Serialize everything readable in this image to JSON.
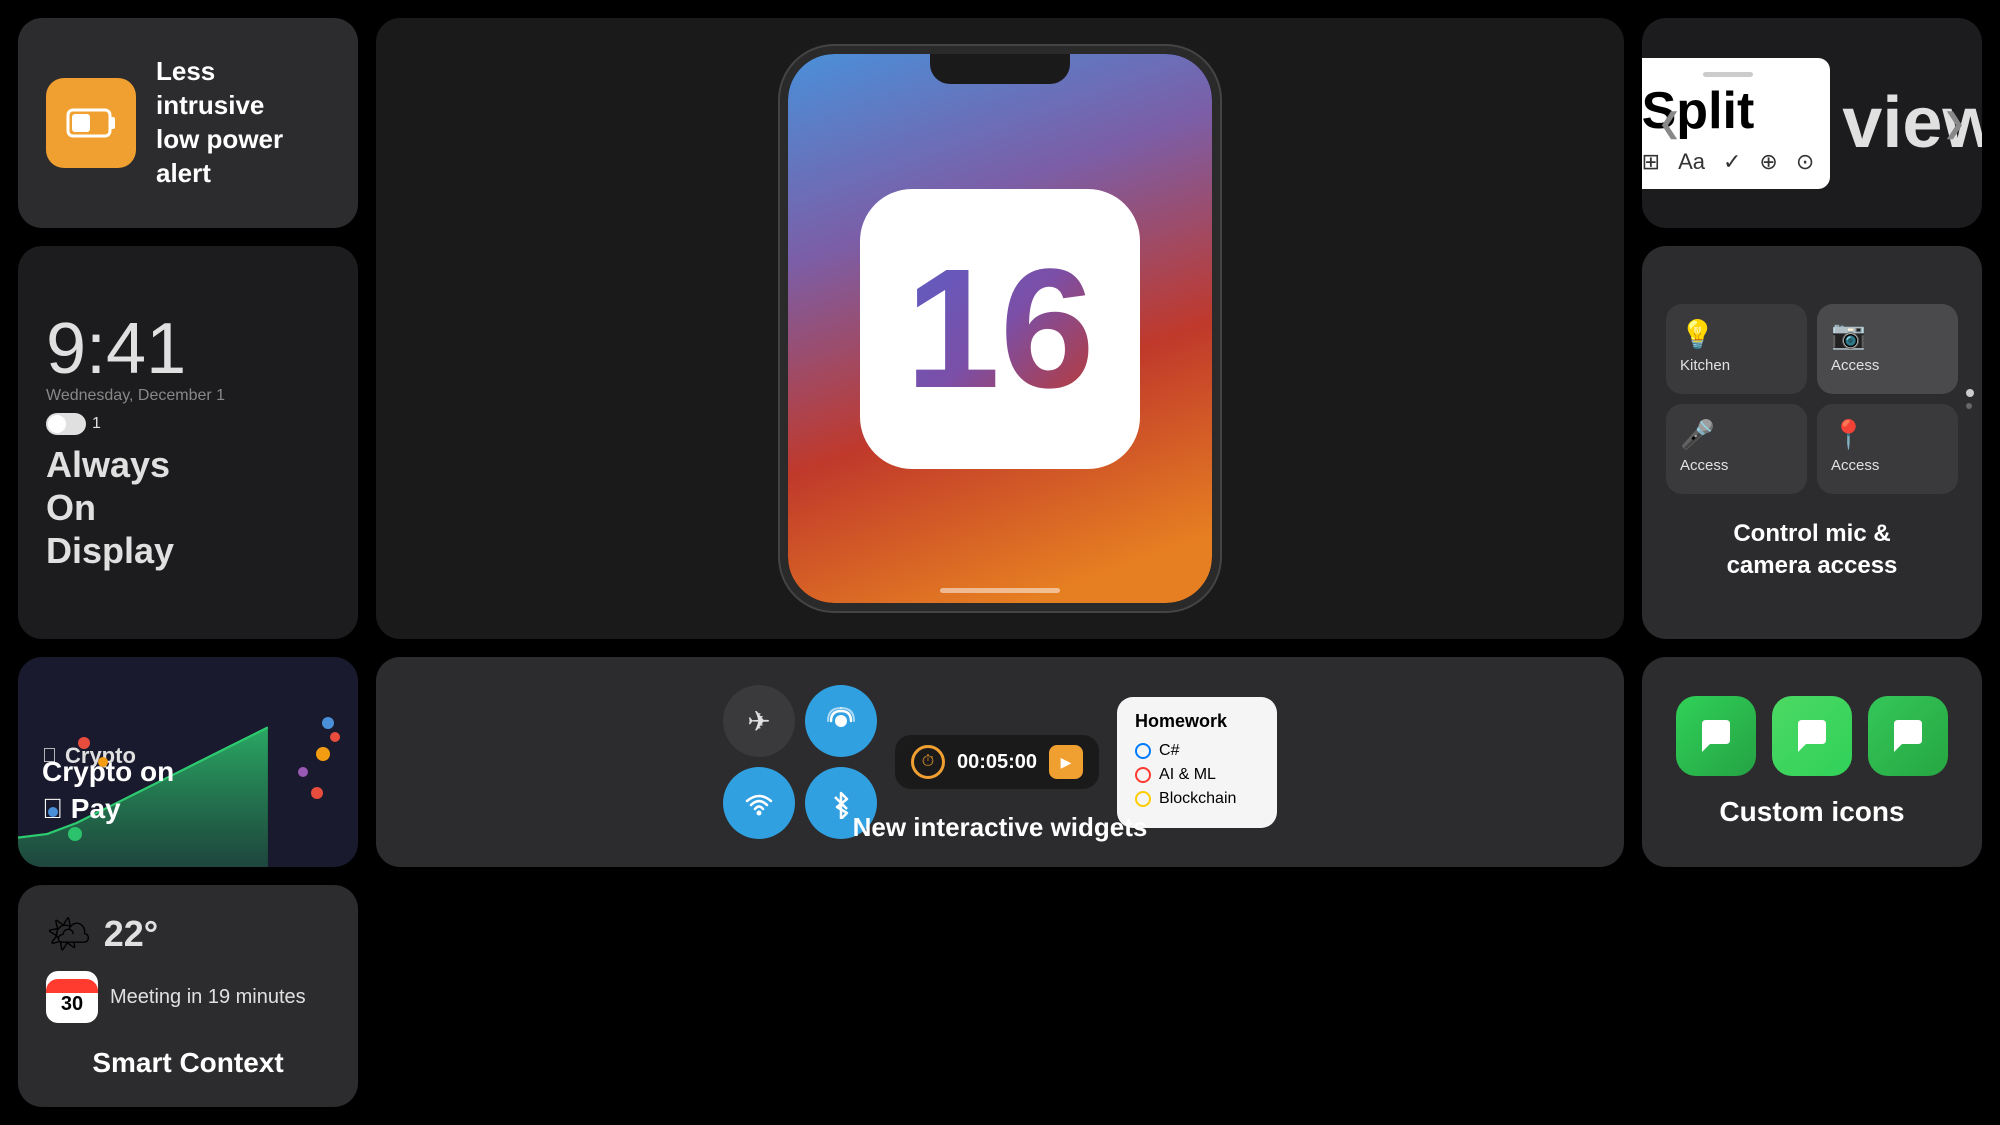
{
  "cards": {
    "low_power": {
      "title_line1": "Less intrusive",
      "title_line2": "low power alert"
    },
    "split_view": {
      "word1": "Split",
      "word2": "view",
      "left_arrow": "❮",
      "right_arrow": "❯"
    },
    "aod": {
      "time": "9:41",
      "date": "Wednesday, December 1",
      "toggle_num": "1",
      "title_line1": "Always",
      "title_line2": "On",
      "title_line3": "Display"
    },
    "camera": {
      "cell1_label": "Kitchen",
      "cell2_label": "Access",
      "cell3_label": "Access",
      "cell4_label": "Access",
      "description_line1": "Control mic &",
      "description_line2": "camera access"
    },
    "crypto": {
      "header": "Crypto",
      "title_line1": "Crypto on",
      "title_line2": "Pay"
    },
    "icons": {
      "label": "Custom icons"
    },
    "widgets": {
      "timer_time": "00:05:00",
      "hw_title": "Homework",
      "hw_item1": "C#",
      "hw_item2": "AI & ML",
      "hw_item3": "Blockchain",
      "label": "New interactive widgets"
    },
    "smart": {
      "temp": "22°",
      "meeting": "Meeting in 19 minutes",
      "cal_day": "30",
      "label": "Smart Context"
    }
  },
  "icons": {
    "battery": "⬜",
    "airplane": "✈",
    "podcast": "📡",
    "wifi": "📶",
    "bluetooth": "🔷",
    "message": "💬",
    "timer": "⏱",
    "play": "▶",
    "sun_cloud": "🌤",
    "camera_icon": "📷",
    "mic_icon": "🎤",
    "mic_slash_icon": "🎙"
  }
}
